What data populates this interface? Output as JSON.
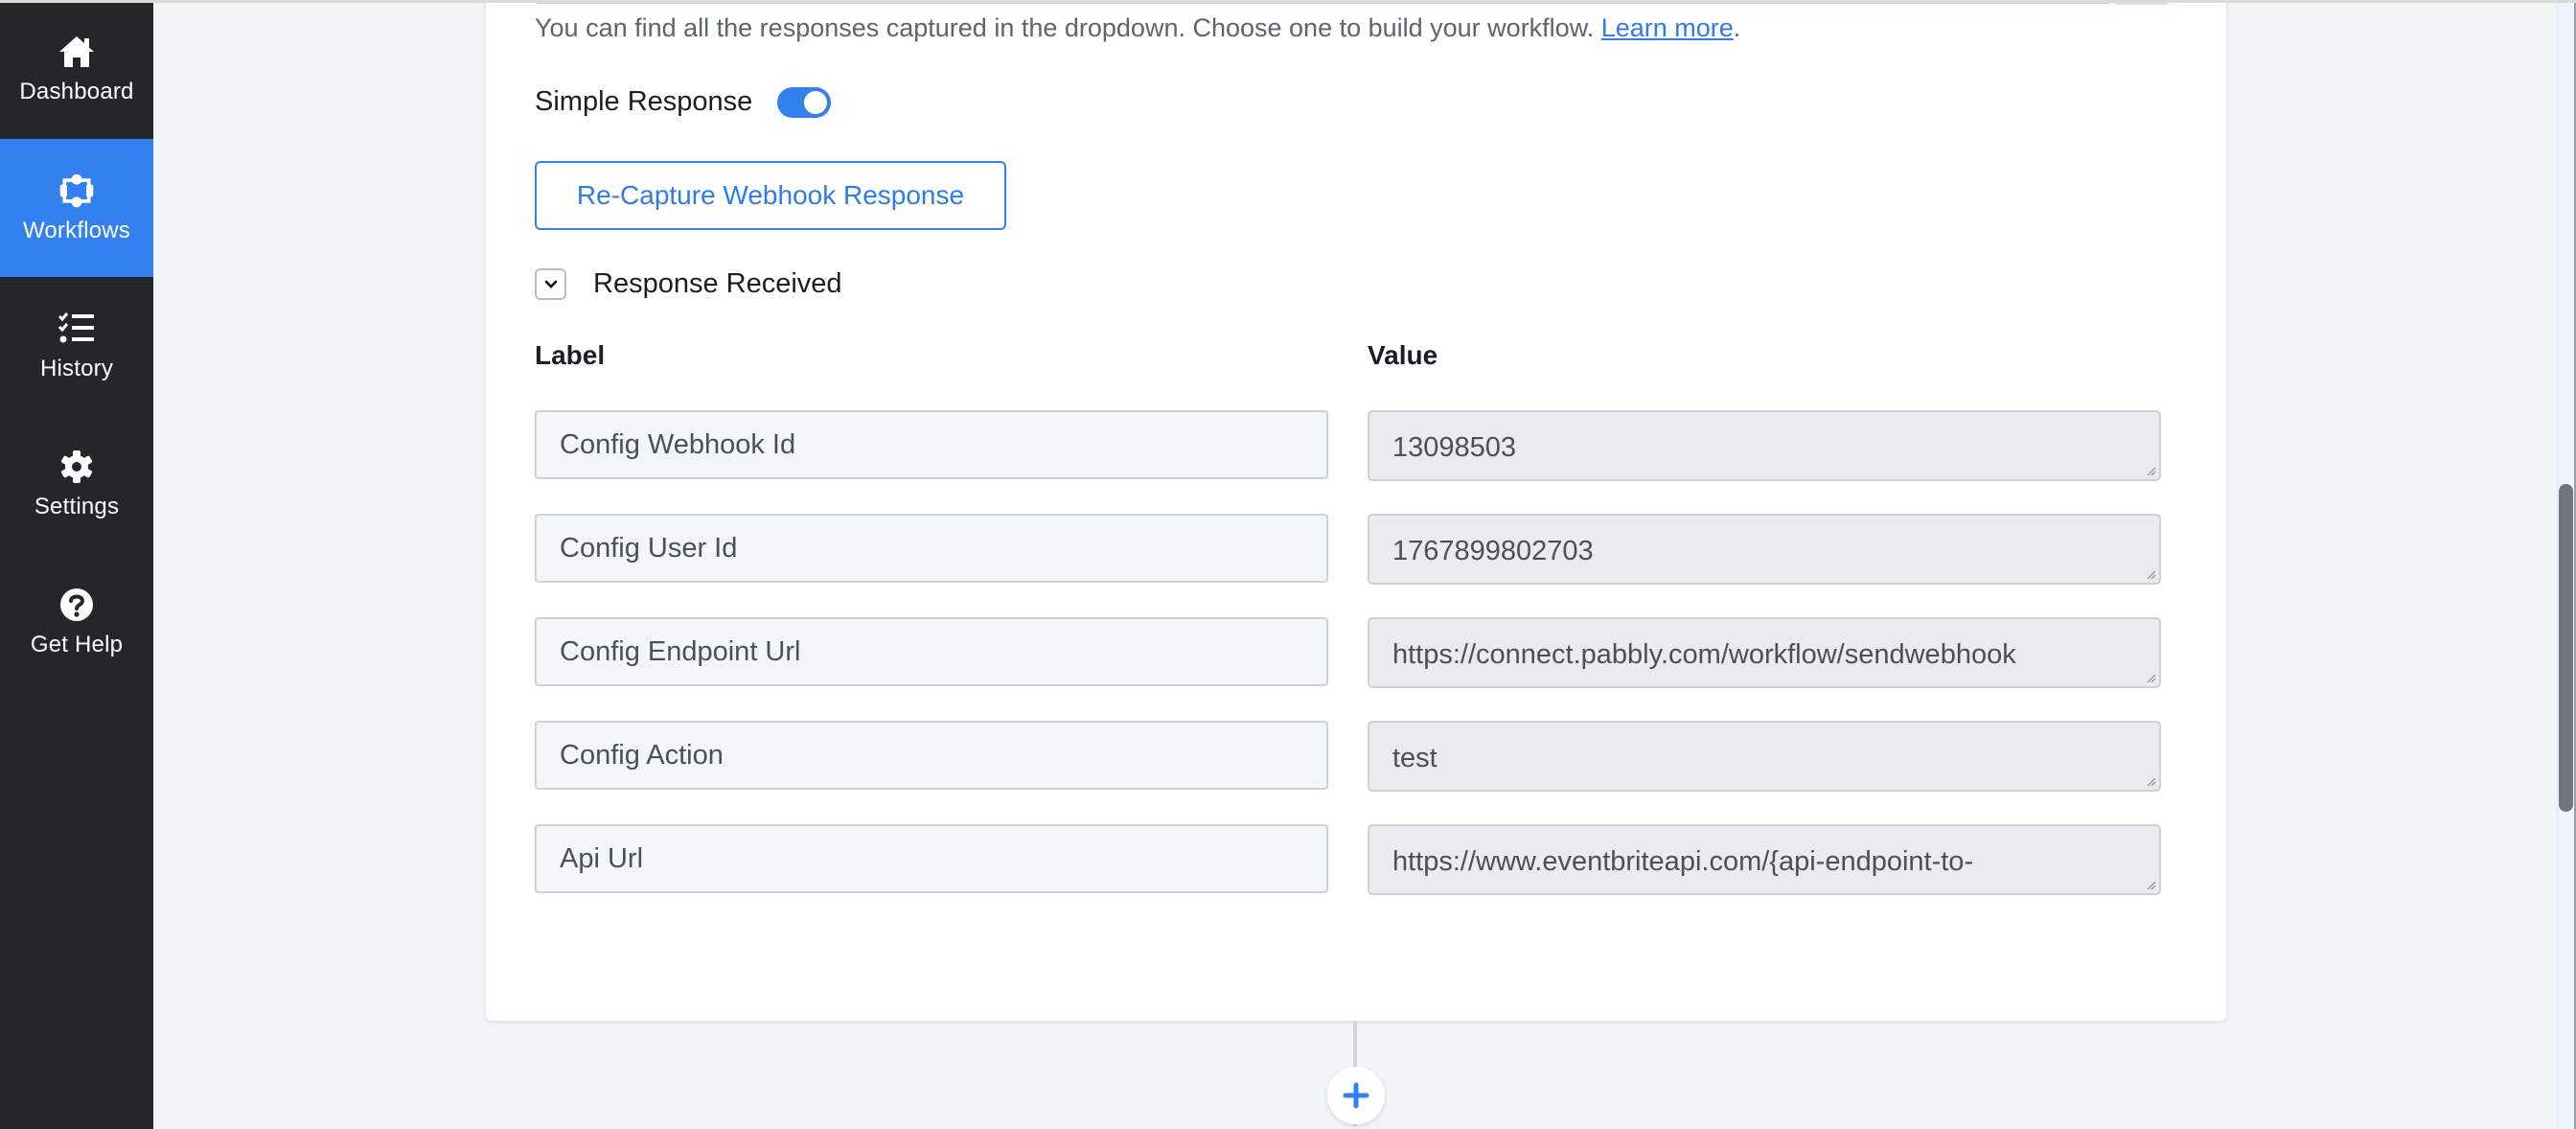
{
  "sidebar": {
    "items": [
      {
        "label": "Dashboard",
        "icon": "home-icon",
        "active": false
      },
      {
        "label": "Workflows",
        "icon": "workflow-icon",
        "active": true
      },
      {
        "label": "History",
        "icon": "checklist-icon",
        "active": false
      },
      {
        "label": "Settings",
        "icon": "gear-icon",
        "active": false
      },
      {
        "label": "Get Help",
        "icon": "question-circle-icon",
        "active": false
      }
    ]
  },
  "main": {
    "hint_text": "You can find all the responses captured in the dropdown. Choose one to build your workflow. ",
    "hint_link": "Learn more",
    "hint_end": ".",
    "simple_response_label": "Simple Response",
    "simple_response_enabled": true,
    "recapture_button": "Re-Capture Webhook Response",
    "response_received_label": "Response Received",
    "columns": {
      "label": "Label",
      "value": "Value"
    },
    "rows": [
      {
        "label": "Config Webhook Id",
        "value": "13098503"
      },
      {
        "label": "Config User Id",
        "value": "1767899802703"
      },
      {
        "label": "Config Endpoint Url",
        "value": "https://connect.pabbly.com/workflow/sendwebhook"
      },
      {
        "label": "Config Action",
        "value": "test"
      },
      {
        "label": "Api Url",
        "value": "https://www.eventbriteapi.com/{api-endpoint-to-"
      }
    ]
  },
  "colors": {
    "accent": "#3380f0",
    "sidebar_bg": "#23262b",
    "page_bg": "#f2f5f8"
  }
}
